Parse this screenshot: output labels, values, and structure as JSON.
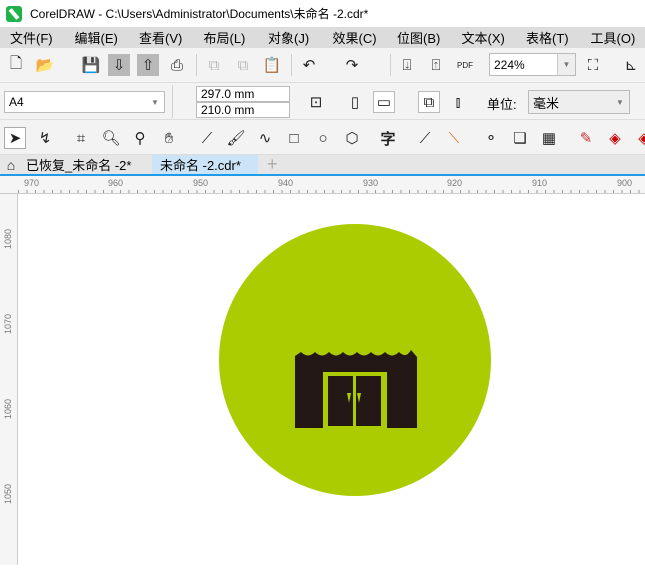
{
  "window": {
    "title": "CorelDRAW - C:\\Users\\Administrator\\Documents\\未命名 -2.cdr*"
  },
  "menu": [
    "文件(F)",
    "编辑(E)",
    "查看(V)",
    "布局(L)",
    "对象(J)",
    "效果(C)",
    "位图(B)",
    "文本(X)",
    "表格(T)",
    "工具(O)"
  ],
  "toolbar": {
    "zoom": "224%",
    "pdf_label": "PDF"
  },
  "property_bar": {
    "page_size": "A4",
    "width": "297.0 mm",
    "height": "210.0 mm",
    "units_label": "单位:",
    "units": "毫米"
  },
  "tabs": [
    {
      "label": "已恢复_未命名 -2*",
      "active": false
    },
    {
      "label": "未命名 -2.cdr*",
      "active": true
    }
  ],
  "rulers": {
    "horizontal": [
      "970",
      "960",
      "950",
      "940",
      "930",
      "920",
      "910",
      "900"
    ],
    "vertical": [
      "1080",
      "1070",
      "1060",
      "1050"
    ]
  },
  "artwork": {
    "circle_color": "#aacc00",
    "icon_color": "#231815"
  }
}
